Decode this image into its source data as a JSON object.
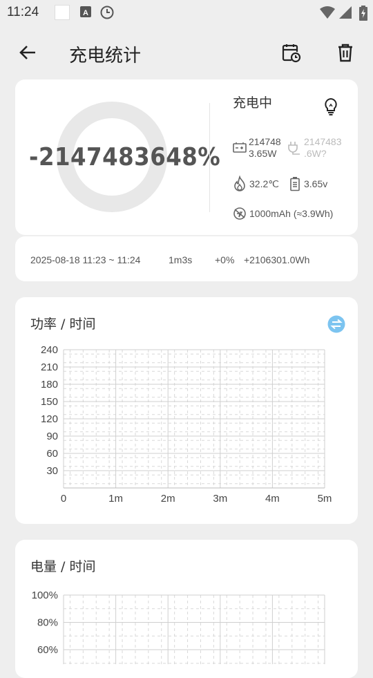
{
  "status_bar": {
    "time": "11:24"
  },
  "toolbar": {
    "title": "充电统计"
  },
  "battery": {
    "percent_display": "-2147483648%",
    "status": "充电中",
    "battery_power_line1": "214748",
    "battery_power_line2": "3.65W",
    "adapter_power_line1": "2147483",
    "adapter_power_line2": ".6W?",
    "temperature": "32.2℃",
    "voltage": "3.65v",
    "capacity": "1000mAh (≈3.9Wh)"
  },
  "summary": {
    "time_range": "2025-08-18  11:23 ~ 11:24",
    "duration": "1m3s",
    "percent_change": "+0%",
    "energy": "+2106301.0Wh"
  },
  "charts": {
    "power_title": "功率 / 时间",
    "level_title": "电量 / 时间"
  },
  "colors": {
    "accent": "#7cc4f0"
  },
  "chart_data": [
    {
      "type": "line",
      "title": "功率 / 时间",
      "x_tick_labels": [
        "0",
        "1m",
        "2m",
        "3m",
        "4m",
        "5m"
      ],
      "y_tick_labels": [
        "240",
        "210",
        "180",
        "150",
        "120",
        "90",
        "60",
        "30"
      ],
      "ylim": [
        0,
        240
      ],
      "series": [],
      "grid": true
    },
    {
      "type": "line",
      "title": "电量 / 时间",
      "y_tick_labels": [
        "100%",
        "80%",
        "60%"
      ],
      "series": [],
      "grid": true
    }
  ]
}
